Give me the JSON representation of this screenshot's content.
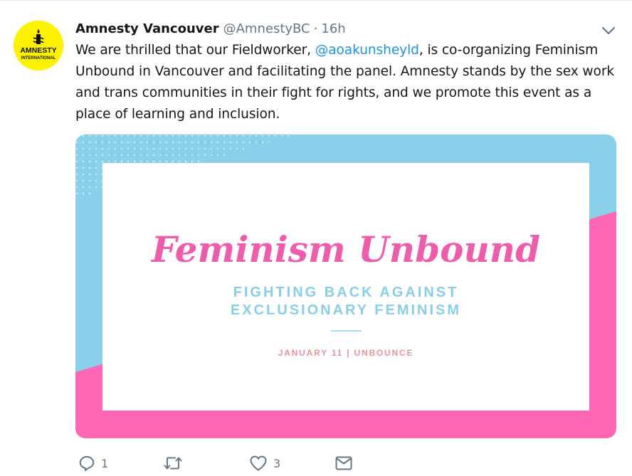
{
  "tweet": {
    "author": {
      "display_name": "Amnesty Vancouver",
      "handle": "@AmnestyBC",
      "avatar_text_top": "AMNESTY",
      "avatar_text_bottom": "INTERNATIONAL",
      "avatar_color": "#fff200"
    },
    "separator": "·",
    "time": "16h",
    "text_before_mention": "We are thrilled that our Fieldworker, ",
    "mention": "@aoakunsheyld",
    "text_after_mention": ", is co-organizing Feminism Unbound in Vancouver and facilitating the panel. Amnesty stands by the sex work and trans communities in their fight for rights, and we promote this event as a place of learning and inclusion.",
    "media": {
      "title": "Feminism Unbound",
      "subtitle_line1": "FIGHTING BACK AGAINST",
      "subtitle_line2": "EXCLUSIONARY FEMINISM",
      "date_line": "JANUARY 11 | UNBOUNCE",
      "colors": {
        "blue": "#8ad0ea",
        "pink": "#ff66b3",
        "title": "#ee5cac",
        "subtitle": "#88cfe6",
        "date": "#e8949a"
      }
    },
    "actions": {
      "reply_icon": "reply-icon",
      "reply_count": "1",
      "retweet_icon": "retweet-icon",
      "like_icon": "heart-icon",
      "like_count": "3",
      "dm_icon": "envelope-icon"
    }
  }
}
